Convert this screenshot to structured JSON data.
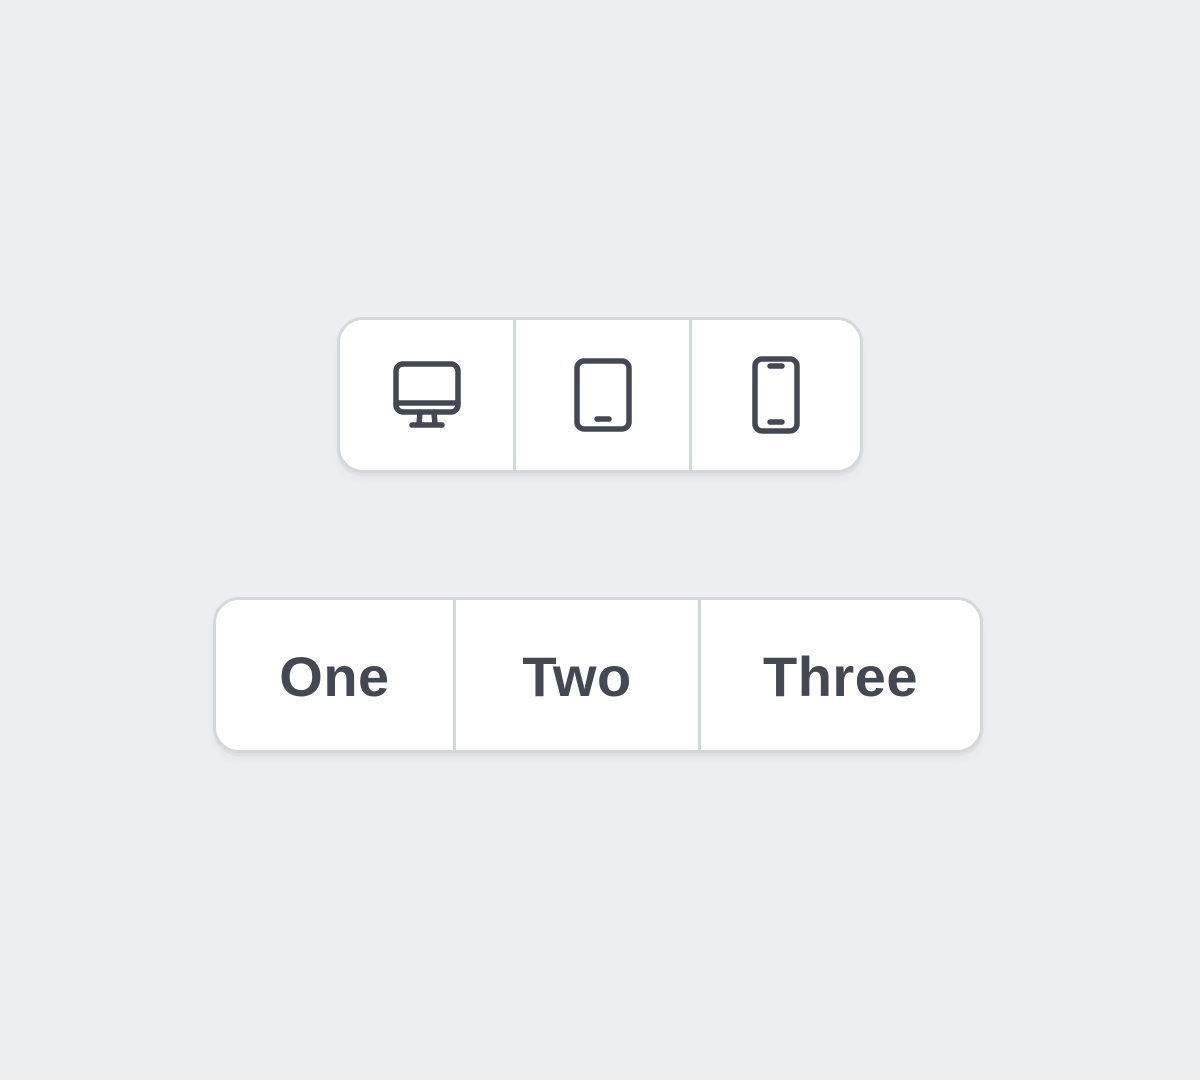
{
  "device_switcher": {
    "items": [
      {
        "icon": "desktop-icon"
      },
      {
        "icon": "tablet-icon"
      },
      {
        "icon": "phone-icon"
      }
    ]
  },
  "segmented_control": {
    "items": [
      {
        "label": "One"
      },
      {
        "label": "Two"
      },
      {
        "label": "Three"
      }
    ]
  },
  "colors": {
    "background": "#edeef2",
    "surface": "#ffffff",
    "border": "#d6d7db",
    "foreground": "#434852"
  }
}
